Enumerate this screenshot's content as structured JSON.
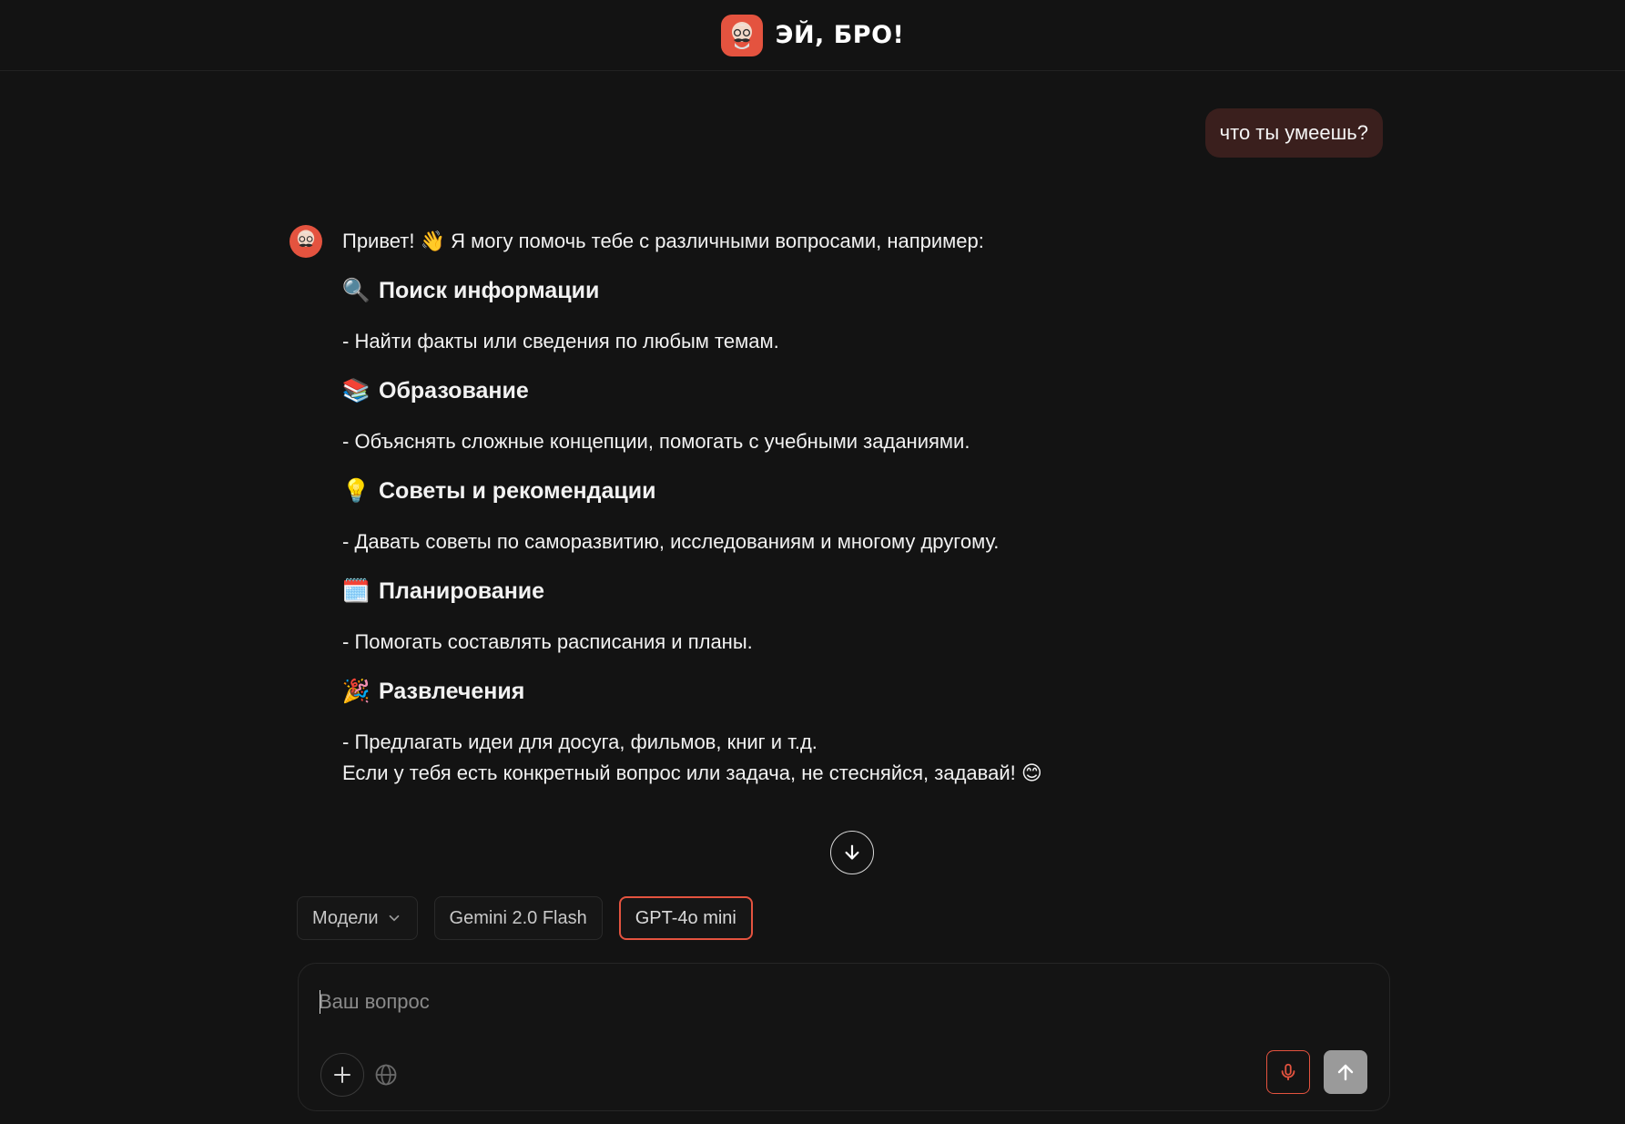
{
  "header": {
    "title": "ЭЙ, БРО!",
    "logo_icon": "mustache-bro-icon"
  },
  "conversation": {
    "user_message": "что ты умеешь?",
    "bot": {
      "intro": "Привет! 👋 Я могу помочь тебе с различными вопросами, например:",
      "sections": [
        {
          "emoji": "🔍",
          "title": "Поиск информации",
          "desc": "- Найти факты или сведения по любым темам."
        },
        {
          "emoji": "📚",
          "title": "Образование",
          "desc": "- Объяснять сложные концепции, помогать с учебными заданиями."
        },
        {
          "emoji": "💡",
          "title": "Советы и рекомендации",
          "desc": "- Давать советы по саморазвитию, исследованиям и многому другому."
        },
        {
          "emoji": "🗓️",
          "title": "Планирование",
          "desc": "- Помогать составлять расписания и планы."
        },
        {
          "emoji": "🎉",
          "title": "Развлечения",
          "desc": "- Предлагать идеи для досуга, фильмов, книг и т.д."
        }
      ],
      "outro": "Если у тебя есть конкретный вопрос или задача, не стесняйся, задавай! 😊"
    }
  },
  "models": {
    "dropdown_label": "Модели",
    "options": [
      "Gemini 2.0 Flash",
      "GPT-4o mini"
    ],
    "selected": "GPT-4o mini"
  },
  "composer": {
    "placeholder": "Ваш вопрос",
    "value": ""
  },
  "colors": {
    "accent": "#e4533f",
    "background": "#131313",
    "user_bubble": "#3a1f1d"
  }
}
